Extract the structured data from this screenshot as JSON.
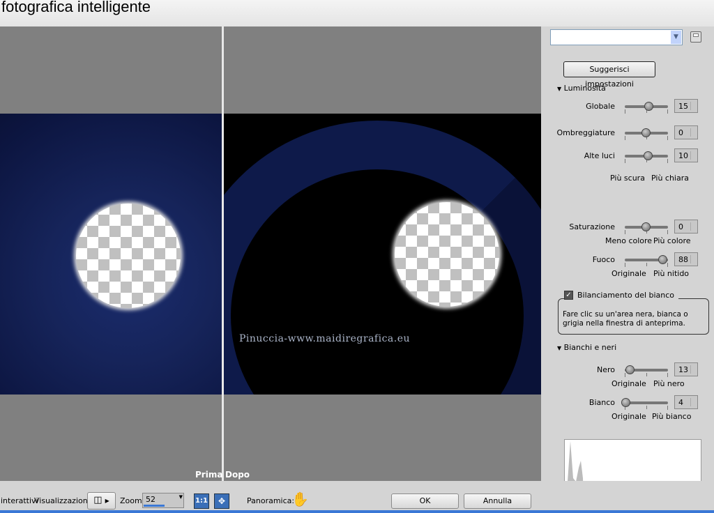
{
  "window": {
    "title": "fotografica intelligente"
  },
  "preview": {
    "before_label": "Prima",
    "after_label": "Dopo",
    "watermark": "Pinuccia-www.maidiregrafica.eu"
  },
  "panel": {
    "preset_value": "",
    "suggest_button": "Suggerisci impostazioni",
    "luminosity": {
      "title": "Luminosità",
      "sliders": [
        {
          "label": "Globale",
          "value": "15",
          "level": 0.56
        },
        {
          "label": "Ombreggiature",
          "value": "0",
          "level": 0.5
        },
        {
          "label": "Alte luci",
          "value": "10",
          "level": 0.55
        }
      ],
      "left_caption": "Più scura",
      "right_caption": "Più chiara"
    },
    "saturation": {
      "label": "Saturazione",
      "value": "0",
      "level": 0.5,
      "left_caption": "Meno colore",
      "right_caption": "Più colore"
    },
    "focus": {
      "label": "Fuoco",
      "value": "88",
      "level": 0.88,
      "left_caption": "Originale",
      "right_caption": "Più nitido"
    },
    "white_balance": {
      "label": "Bilanciamento del bianco",
      "checked": true,
      "hint": "Fare clic su un'area nera, bianca o grigia nella finestra di anteprima."
    },
    "blacks_whites": {
      "title": "Bianchi e neri",
      "black": {
        "label": "Nero",
        "value": "13",
        "level": 0.13,
        "left_caption": "Originale",
        "right_caption": "Più nero"
      },
      "white": {
        "label": "Bianco",
        "value": "4",
        "level": 0.04,
        "left_caption": "Originale",
        "right_caption": "Più bianco"
      }
    }
  },
  "bottom": {
    "interactive_label": "interattivi",
    "view_label": "Visualizzazione:",
    "zoom_label": "Zoom:",
    "zoom_value": "52",
    "one_to_one": "1:1",
    "pan_label": "Panoramica:",
    "ok": "OK",
    "cancel": "Annulla"
  },
  "colors": {
    "accent": "#3a78d6",
    "image_blue": "#16245a"
  }
}
